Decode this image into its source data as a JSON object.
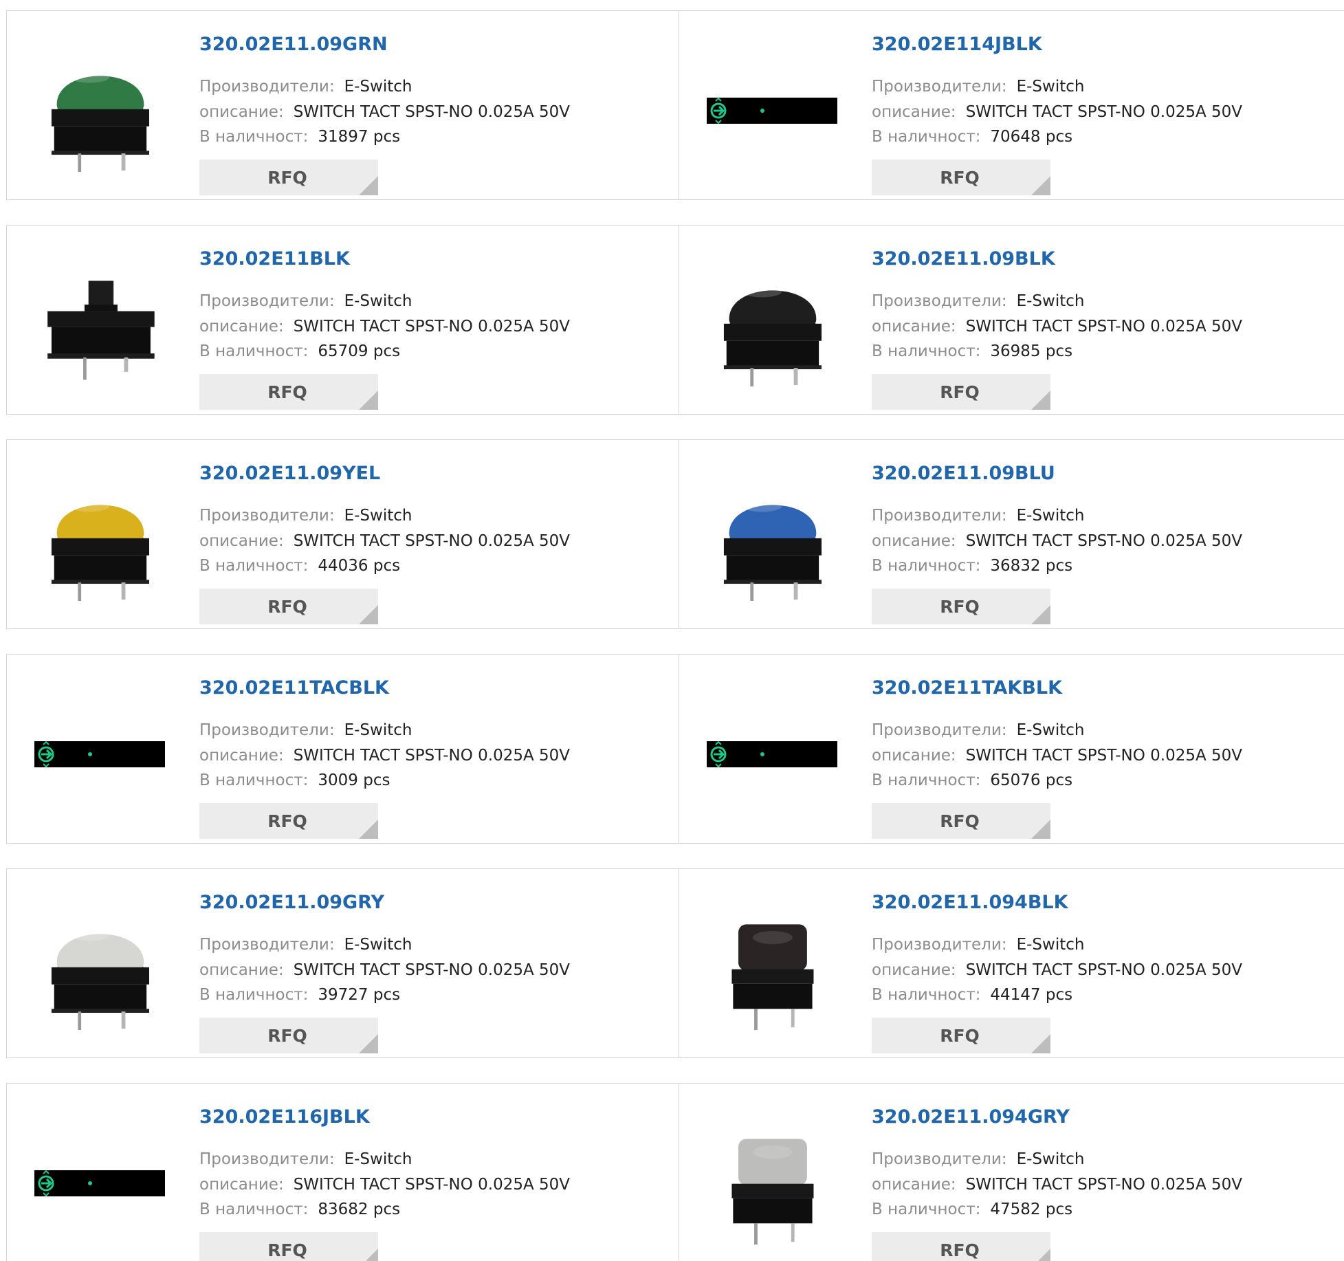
{
  "labels": {
    "manufacturer": "Производители:",
    "description": "описание:",
    "stock": "В наличност:",
    "rfq": "RFQ"
  },
  "products": [
    {
      "part": "320.02E11.09GRN",
      "manufacturer": "E-Switch",
      "description": "SWITCH TACT SPST-NO 0.025A 50V",
      "stock": "31897 pcs",
      "image": "round-cap",
      "cap_color": "#2f7a45"
    },
    {
      "part": "320.02E114JBLK",
      "manufacturer": "E-Switch",
      "description": "SWITCH TACT SPST-NO 0.025A 50V",
      "stock": "70648 pcs",
      "image": "placeholder",
      "cap_color": ""
    },
    {
      "part": "320.02E11BLK",
      "manufacturer": "E-Switch",
      "description": "SWITCH TACT SPST-NO 0.025A 50V",
      "stock": "65709 pcs",
      "image": "plunger",
      "cap_color": "#1c1c1c"
    },
    {
      "part": "320.02E11.09BLK",
      "manufacturer": "E-Switch",
      "description": "SWITCH TACT SPST-NO 0.025A 50V",
      "stock": "36985 pcs",
      "image": "round-cap",
      "cap_color": "#1e1e1e"
    },
    {
      "part": "320.02E11.09YEL",
      "manufacturer": "E-Switch",
      "description": "SWITCH TACT SPST-NO 0.025A 50V",
      "stock": "44036 pcs",
      "image": "round-cap",
      "cap_color": "#d9b11c"
    },
    {
      "part": "320.02E11.09BLU",
      "manufacturer": "E-Switch",
      "description": "SWITCH TACT SPST-NO 0.025A 50V",
      "stock": "36832 pcs",
      "image": "round-cap",
      "cap_color": "#2f63b3"
    },
    {
      "part": "320.02E11TACBLK",
      "manufacturer": "E-Switch",
      "description": "SWITCH TACT SPST-NO 0.025A 50V",
      "stock": "3009 pcs",
      "image": "placeholder",
      "cap_color": ""
    },
    {
      "part": "320.02E11TAKBLK",
      "manufacturer": "E-Switch",
      "description": "SWITCH TACT SPST-NO 0.025A 50V",
      "stock": "65076 pcs",
      "image": "placeholder",
      "cap_color": ""
    },
    {
      "part": "320.02E11.09GRY",
      "manufacturer": "E-Switch",
      "description": "SWITCH TACT SPST-NO 0.025A 50V",
      "stock": "39727 pcs",
      "image": "round-cap",
      "cap_color": "#d6d6d2"
    },
    {
      "part": "320.02E11.094BLK",
      "manufacturer": "E-Switch",
      "description": "SWITCH TACT SPST-NO 0.025A 50V",
      "stock": "44147 pcs",
      "image": "square-cap",
      "cap_color": "#2a2424"
    },
    {
      "part": "320.02E116JBLK",
      "manufacturer": "E-Switch",
      "description": "SWITCH TACT SPST-NO 0.025A 50V",
      "stock": "83682 pcs",
      "image": "placeholder",
      "cap_color": ""
    },
    {
      "part": "320.02E11.094GRY",
      "manufacturer": "E-Switch",
      "description": "SWITCH TACT SPST-NO 0.025A 50V",
      "stock": "47582 pcs",
      "image": "square-cap",
      "cap_color": "#bdbdbb"
    }
  ]
}
